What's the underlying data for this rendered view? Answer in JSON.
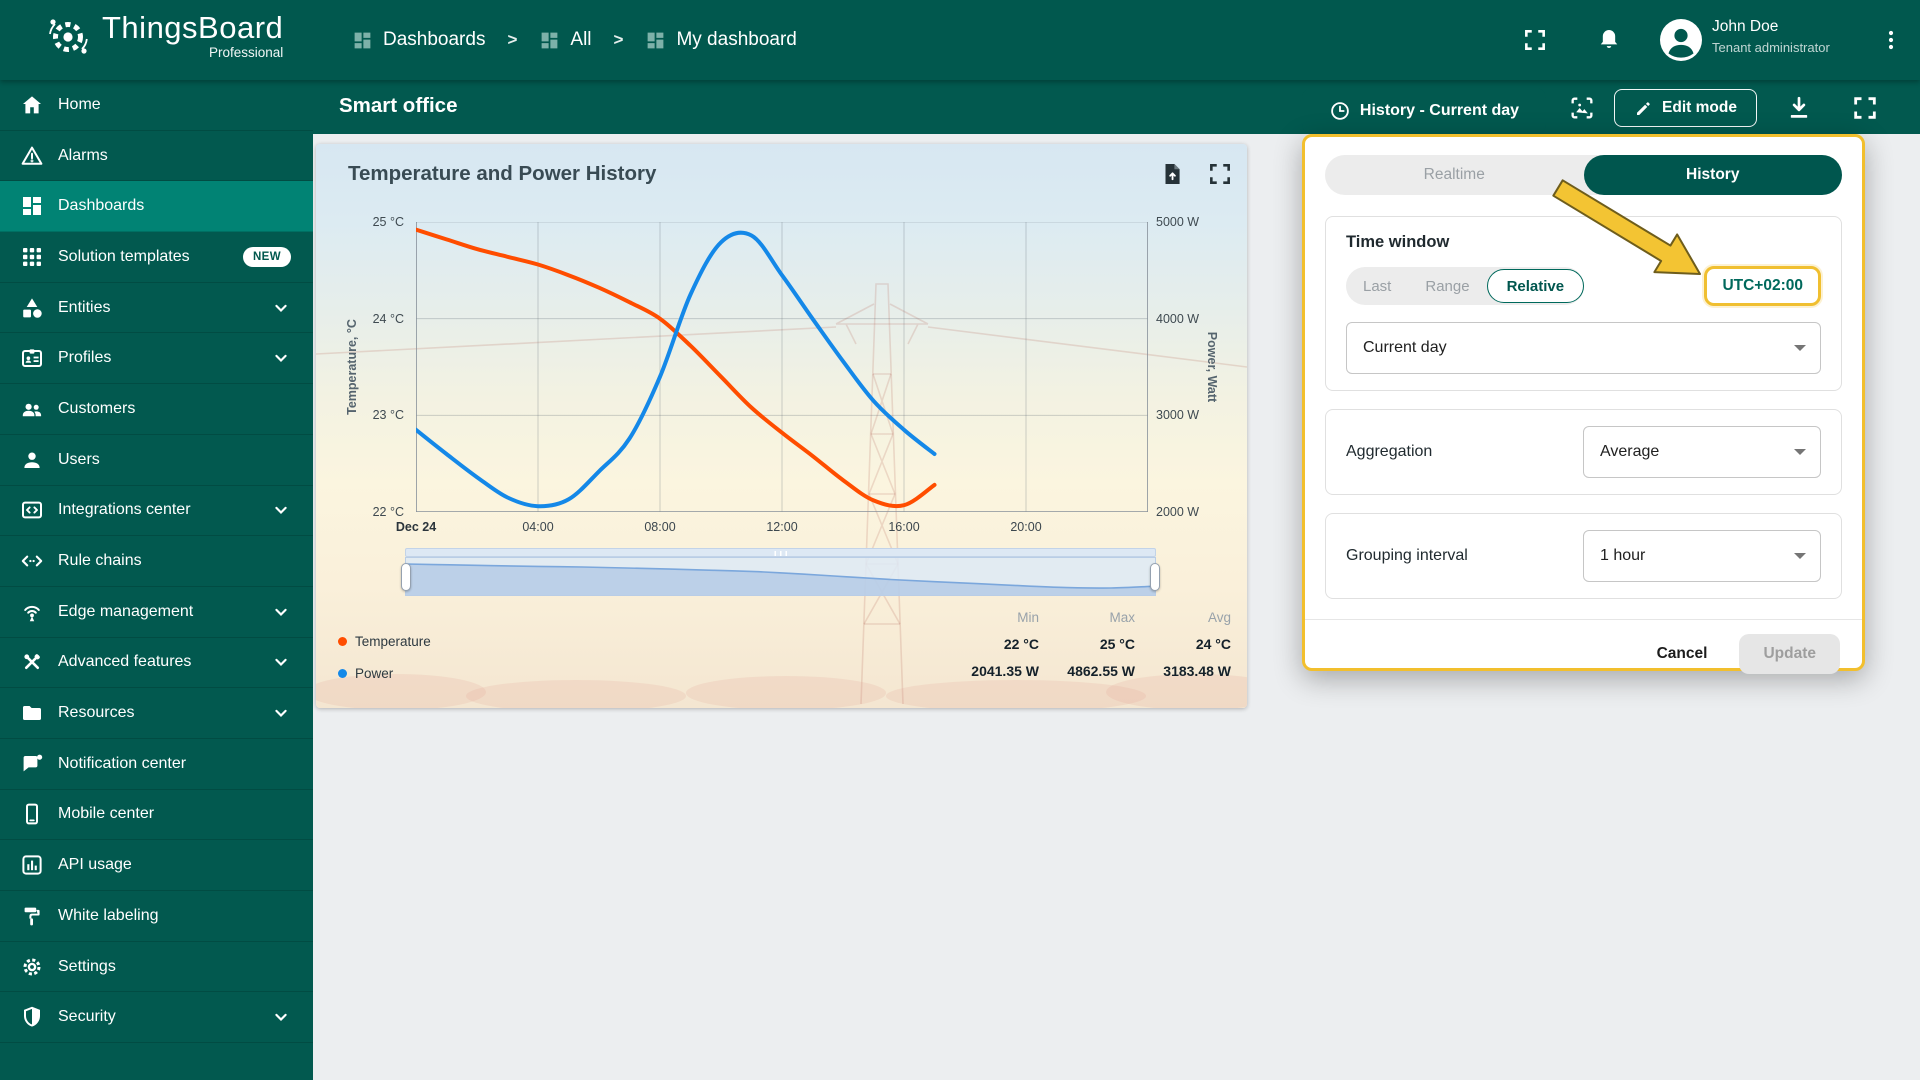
{
  "colors": {
    "brand_teal": "#01584E",
    "sidebar_selected": "#018374",
    "highlight_yellow": "#F2BF2D",
    "temperature_series": "#FF4D00",
    "power_series": "#1488E8",
    "history_pill": "#00564E",
    "teal_text": "#00695C"
  },
  "header": {
    "brand": {
      "name": "ThingsBoard",
      "edition": "Professional"
    },
    "breadcrumb": [
      {
        "label": "Dashboards"
      },
      {
        "label": "All"
      },
      {
        "label": "My dashboard"
      }
    ],
    "user": {
      "name": "John Doe",
      "role": "Tenant administrator"
    }
  },
  "sidebar": {
    "items": [
      {
        "label": "Home",
        "icon": "home-icon"
      },
      {
        "label": "Alarms",
        "icon": "alarm-icon"
      },
      {
        "label": "Dashboards",
        "icon": "dashboards-icon",
        "selected": true
      },
      {
        "label": "Solution templates",
        "icon": "solution-templates-icon",
        "badge": "NEW"
      },
      {
        "label": "Entities",
        "icon": "entities-icon",
        "expandable": true
      },
      {
        "label": "Profiles",
        "icon": "profiles-icon",
        "expandable": true
      },
      {
        "label": "Customers",
        "icon": "customers-icon"
      },
      {
        "label": "Users",
        "icon": "users-icon"
      },
      {
        "label": "Integrations center",
        "icon": "integrations-icon",
        "expandable": true
      },
      {
        "label": "Rule chains",
        "icon": "rule-chains-icon"
      },
      {
        "label": "Edge management",
        "icon": "edge-management-icon",
        "expandable": true
      },
      {
        "label": "Advanced features",
        "icon": "advanced-features-icon",
        "expandable": true
      },
      {
        "label": "Resources",
        "icon": "resources-icon",
        "expandable": true
      },
      {
        "label": "Notification center",
        "icon": "notification-icon"
      },
      {
        "label": "Mobile center",
        "icon": "mobile-icon"
      },
      {
        "label": "API usage",
        "icon": "api-usage-icon"
      },
      {
        "label": "White labeling",
        "icon": "white-labeling-icon"
      },
      {
        "label": "Settings",
        "icon": "settings-icon"
      },
      {
        "label": "Security",
        "icon": "security-icon",
        "expandable": true
      }
    ]
  },
  "toolbar": {
    "title": "Smart office",
    "timewindow_button": "History - Current day",
    "edit_button": "Edit mode"
  },
  "widget": {
    "title": "Temperature and Power History",
    "legend": {
      "headers": [
        "Min",
        "Max",
        "Avg"
      ],
      "rows": [
        {
          "name": "Temperature",
          "min": "22 °C",
          "max": "25 °C",
          "avg": "24 °C"
        },
        {
          "name": "Power",
          "min": "2041.35 W",
          "max": "4862.55 W",
          "avg": "3183.48 W"
        }
      ]
    }
  },
  "chart_data": {
    "type": "line",
    "title": "Temperature and Power History",
    "x_hours": [
      0,
      1,
      2,
      3,
      4,
      5,
      6,
      7,
      8,
      9,
      10,
      11,
      12,
      13,
      14,
      15,
      16,
      17
    ],
    "x_tick_hours": [
      0,
      4,
      8,
      12,
      16,
      20
    ],
    "x_tick_labels": [
      "Dec 24",
      "04:00",
      "08:00",
      "12:00",
      "16:00",
      "20:00"
    ],
    "x_range_hours": [
      0,
      24
    ],
    "y_left": {
      "label": "Temperature, °C",
      "ticks": [
        "25 °C",
        "24 °C",
        "23 °C",
        "22 °C"
      ],
      "range": [
        22,
        25
      ]
    },
    "y_right": {
      "label": "Power, Watt",
      "ticks": [
        "5000 W",
        "4000 W",
        "3000 W",
        "2000 W"
      ],
      "range": [
        2000,
        5000
      ]
    },
    "grid": true,
    "legend_position": "bottom",
    "series": [
      {
        "name": "Temperature",
        "axis": "left",
        "color": "#FF4D00",
        "values": [
          24.92,
          24.82,
          24.72,
          24.64,
          24.56,
          24.45,
          24.32,
          24.17,
          24.0,
          23.72,
          23.4,
          23.08,
          22.82,
          22.58,
          22.33,
          22.12,
          22.07,
          22.28
        ]
      },
      {
        "name": "Power",
        "axis": "right",
        "color": "#1488E8",
        "values": [
          2850,
          2600,
          2360,
          2150,
          2060,
          2130,
          2420,
          2760,
          3400,
          4250,
          4790,
          4860,
          4450,
          4000,
          3560,
          3150,
          2850,
          2600
        ]
      }
    ]
  },
  "panel": {
    "mode_toggle": {
      "options": [
        "Realtime",
        "History"
      ],
      "selected": "History"
    },
    "time_window": {
      "heading": "Time window",
      "tabs": {
        "options": [
          "Last",
          "Range",
          "Relative"
        ],
        "selected": "Relative"
      },
      "timezone": "UTC+02:00",
      "interval_value": "Current day"
    },
    "aggregation": {
      "label": "Aggregation",
      "value": "Average"
    },
    "grouping": {
      "label": "Grouping interval",
      "value": "1 hour"
    },
    "footer": {
      "cancel": "Cancel",
      "update": "Update"
    }
  }
}
